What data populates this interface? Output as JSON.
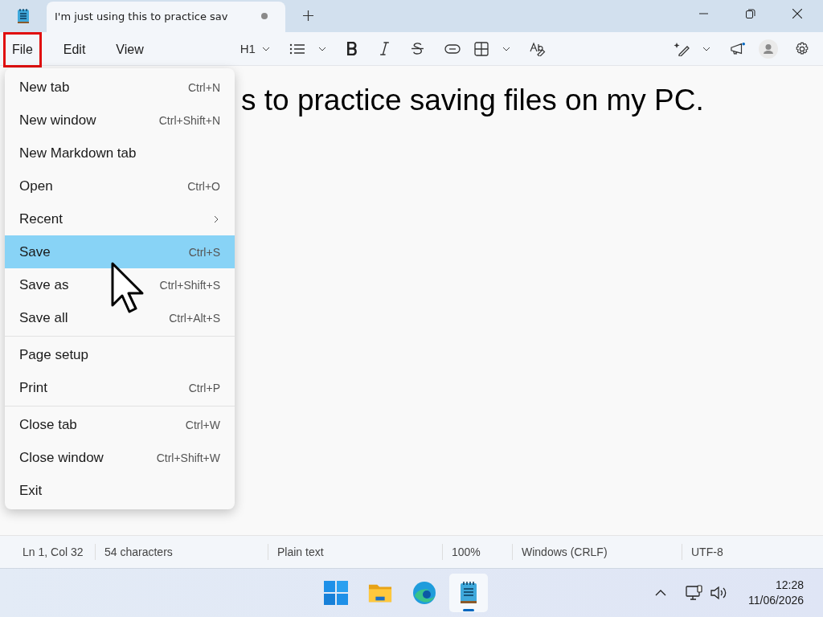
{
  "window": {
    "tab_title": "I'm just using this to practice sav",
    "tab_modified": true
  },
  "menu_bar": [
    {
      "label": "File",
      "outlined": true
    },
    {
      "label": "Edit",
      "outlined": false
    },
    {
      "label": "View",
      "outlined": false
    }
  ],
  "toolbar": {
    "heading": "H1"
  },
  "editor": {
    "text": "s to practice saving files on my PC."
  },
  "file_menu": [
    [
      {
        "label": "New tab",
        "shortcut": "Ctrl+N",
        "selected": false
      },
      {
        "label": "New window",
        "shortcut": "Ctrl+Shift+N",
        "selected": false
      },
      {
        "label": "New Markdown tab",
        "selected": false
      },
      {
        "label": "Open",
        "shortcut": "Ctrl+O",
        "selected": false
      },
      {
        "label": "Recent",
        "submenu": true,
        "selected": false
      },
      {
        "label": "Save",
        "shortcut": "Ctrl+S",
        "selected": true
      },
      {
        "label": "Save as",
        "shortcut": "Ctrl+Shift+S",
        "selected": false
      },
      {
        "label": "Save all",
        "shortcut": "Ctrl+Alt+S",
        "selected": false
      }
    ],
    [
      {
        "label": "Page setup",
        "selected": false
      },
      {
        "label": "Print",
        "shortcut": "Ctrl+P",
        "selected": false
      }
    ],
    [
      {
        "label": "Close tab",
        "shortcut": "Ctrl+W",
        "selected": false
      },
      {
        "label": "Close window",
        "shortcut": "Ctrl+Shift+W",
        "selected": false
      },
      {
        "label": "Exit",
        "selected": false
      }
    ]
  ],
  "status_bar": [
    "Ln 1, Col 32",
    "54 characters",
    "Plain text",
    "100%",
    "Windows (CRLF)",
    "UTF-8"
  ],
  "taskbar": {
    "apps": [
      {
        "kind": "start",
        "selected": false
      },
      {
        "kind": "explorer",
        "selected": false
      },
      {
        "kind": "edge",
        "selected": false
      },
      {
        "kind": "notepad",
        "selected": true
      }
    ],
    "time": "12:28",
    "date": "11/06/2026"
  }
}
